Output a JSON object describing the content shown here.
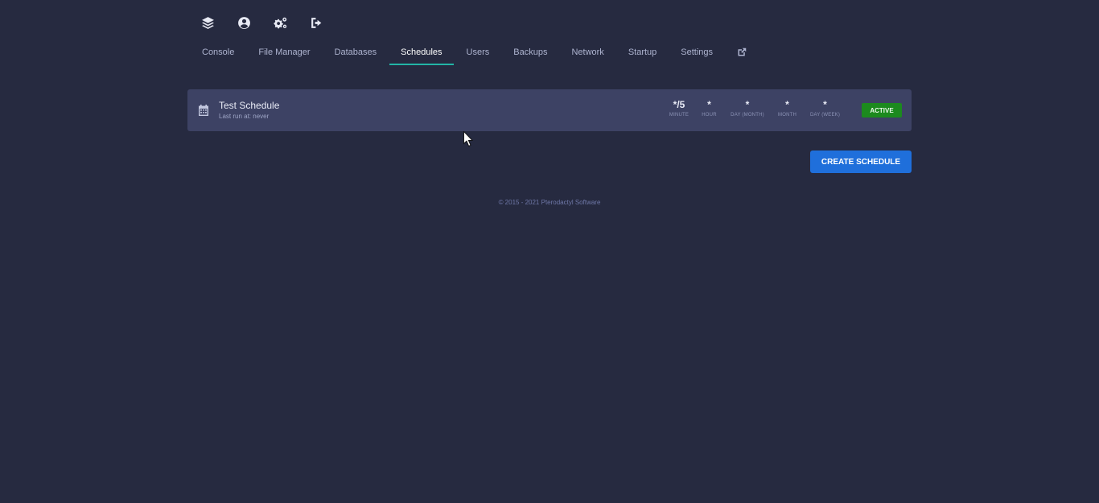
{
  "top_icons": [
    {
      "name": "layers-icon"
    },
    {
      "name": "user-circle-icon"
    },
    {
      "name": "cogs-icon"
    },
    {
      "name": "sign-out-icon"
    }
  ],
  "nav": {
    "tabs": [
      {
        "label": "Console",
        "active": false
      },
      {
        "label": "File Manager",
        "active": false
      },
      {
        "label": "Databases",
        "active": false
      },
      {
        "label": "Schedules",
        "active": true
      },
      {
        "label": "Users",
        "active": false
      },
      {
        "label": "Backups",
        "active": false
      },
      {
        "label": "Network",
        "active": false
      },
      {
        "label": "Startup",
        "active": false
      },
      {
        "label": "Settings",
        "active": false
      }
    ],
    "external_icon": "external-link-icon"
  },
  "schedule": {
    "icon": "calendar-icon",
    "name": "Test Schedule",
    "last_run": "Last run at: never",
    "cron": [
      {
        "value": "*/5",
        "label": "MINUTE"
      },
      {
        "value": "*",
        "label": "HOUR"
      },
      {
        "value": "*",
        "label": "DAY (MONTH)"
      },
      {
        "value": "*",
        "label": "MONTH"
      },
      {
        "value": "*",
        "label": "DAY (WEEK)"
      }
    ],
    "status": "ACTIVE",
    "status_color": "#1c8a1e"
  },
  "create_button": {
    "label": "CREATE SCHEDULE",
    "color": "#1f6fdb"
  },
  "footer": {
    "text": "© 2015 - 2021 Pterodactyl Software"
  },
  "theme": {
    "background": "#262a40",
    "row": "#3d4264",
    "accent": "#22b5a6"
  }
}
